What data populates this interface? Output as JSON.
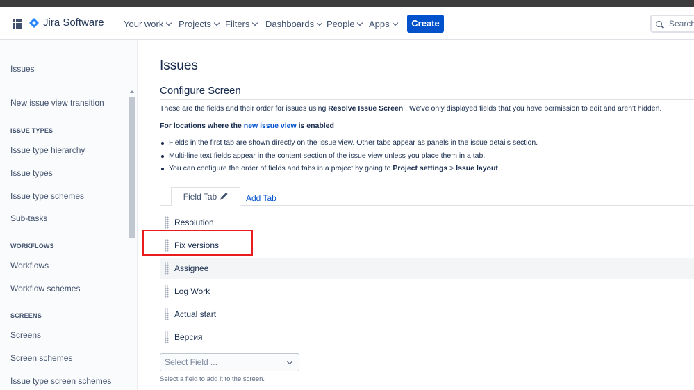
{
  "nav": {
    "logo": "Jira Software",
    "items": [
      "Your work",
      "Projects",
      "Filters",
      "Dashboards",
      "People",
      "Apps"
    ],
    "create_label": "Create",
    "search_placeholder": "Search"
  },
  "sidebar": {
    "title": "Issues",
    "transition": "New issue view transition",
    "issue_types_heading": "ISSUE TYPES",
    "issue_types_items": [
      "Issue type hierarchy",
      "Issue types",
      "Issue type schemes",
      "Sub-tasks"
    ],
    "workflows_heading": "WORKFLOWS",
    "workflows_items": [
      "Workflows",
      "Workflow schemes"
    ],
    "screens_heading": "SCREENS",
    "screens_items": [
      "Screens",
      "Screen schemes",
      "Issue type screen schemes"
    ]
  },
  "main": {
    "page_title": "Issues",
    "section_title": "Configure Screen",
    "desc_prefix": "These are the fields and their order for issues using ",
    "desc_screen": "Resolve Issue Screen",
    "desc_suffix": " . We've only displayed fields that you have permission to edit and aren't hidden.",
    "loc_prefix": "For locations where the ",
    "loc_link": "new issue view",
    "loc_suffix": " is enabled",
    "bullet1": "Fields in the first tab are shown directly on the issue view. Other tabs appear as panels in the issue details section.",
    "bullet2": "Multi-line text fields appear in the content section of the issue view unless you place them in a tab.",
    "bullet3_prefix": "You can configure the order of fields and tabs in a project by going to ",
    "bullet3_settings": "Project settings",
    "bullet3_sep": " > ",
    "bullet3_layout": "Issue layout",
    "bullet3_suffix": " .",
    "tab_field": "Field Tab",
    "tab_add": "Add Tab",
    "fields": [
      "Resolution",
      "Fix versions",
      "Assignee",
      "Log Work",
      "Actual start",
      "Версия"
    ],
    "select_placeholder": "Select Field ...",
    "helper": "Select a field to add it to the screen."
  }
}
